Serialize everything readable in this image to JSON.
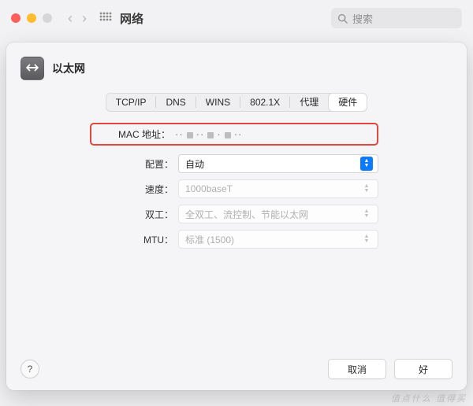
{
  "window": {
    "title": "网络",
    "search_placeholder": "搜索"
  },
  "sheet": {
    "title": "以太网",
    "tabs": [
      "TCP/IP",
      "DNS",
      "WINS",
      "802.1X",
      "代理",
      "硬件"
    ],
    "selected_tab": "硬件",
    "mac": {
      "label": "MAC 地址：",
      "value": "··· ·· ·  ·· ·"
    },
    "rows": {
      "config": {
        "label": "配置：",
        "value": "自动",
        "enabled": true
      },
      "speed": {
        "label": "速度：",
        "value": "1000baseT",
        "enabled": false
      },
      "duplex": {
        "label": "双工：",
        "value": "全双工、流控制、节能以太网",
        "enabled": false
      },
      "mtu": {
        "label": "MTU：",
        "value": "标准 (1500)",
        "enabled": false
      }
    },
    "buttons": {
      "help": "?",
      "cancel": "取消",
      "ok": "好"
    }
  },
  "watermark": "值点什么 值得买"
}
